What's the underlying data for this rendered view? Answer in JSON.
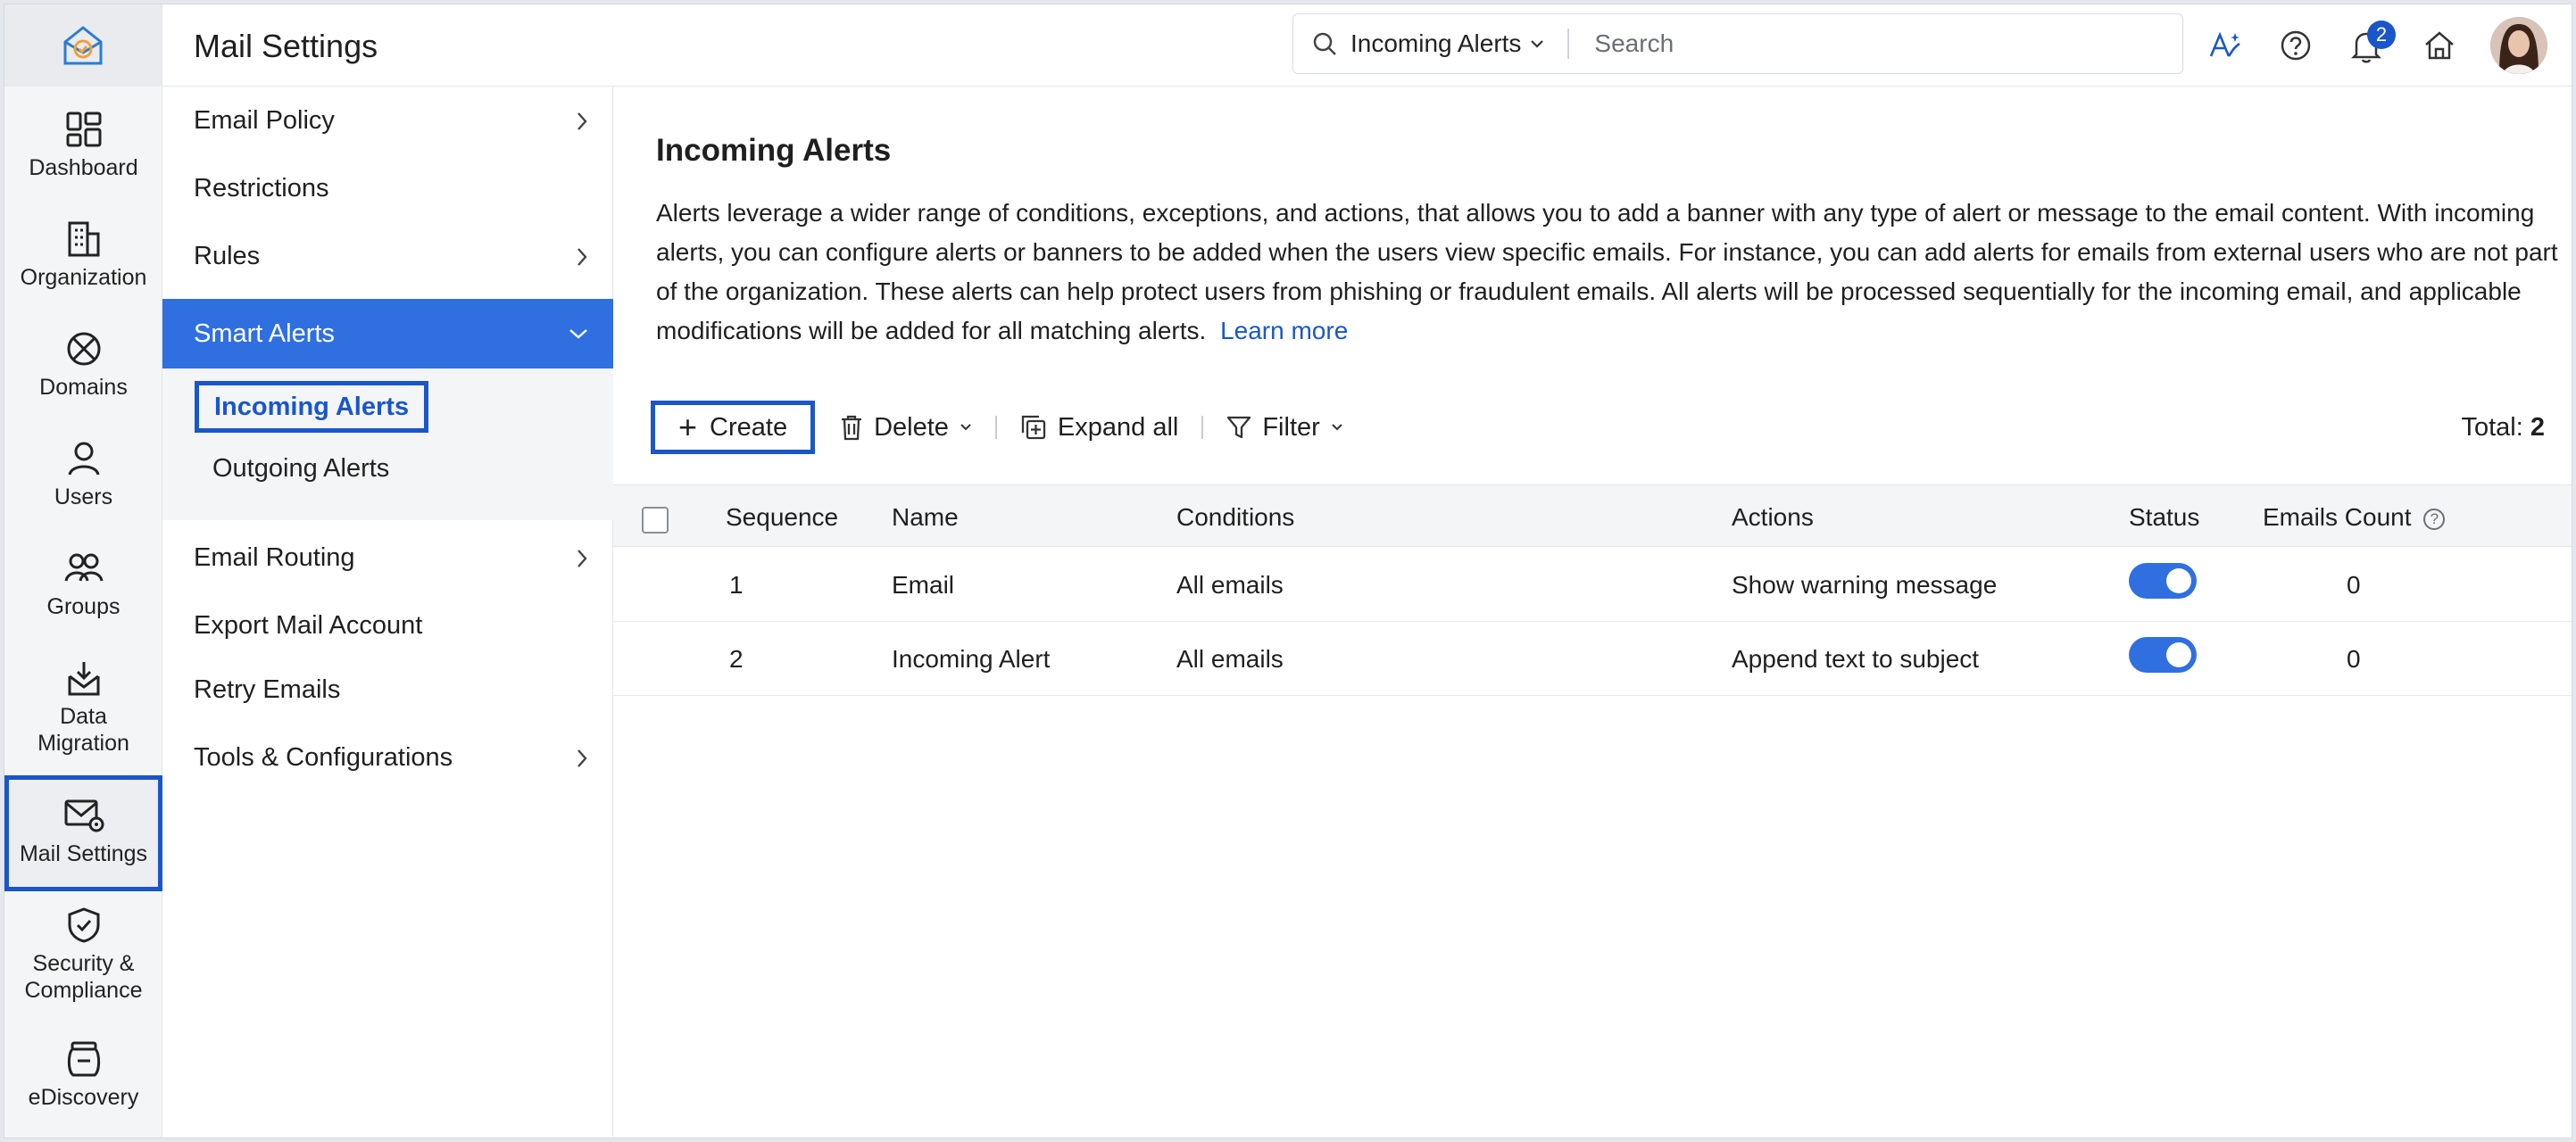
{
  "header": {
    "title": "Mail Settings",
    "search_scope": "Incoming Alerts",
    "search_placeholder": "Search",
    "notification_count": "2"
  },
  "rail": {
    "items": [
      {
        "label": "Dashboard",
        "icon": "dashboard-icon"
      },
      {
        "label": "Organization",
        "icon": "building-icon"
      },
      {
        "label": "Domains",
        "icon": "globe-icon"
      },
      {
        "label": "Users",
        "icon": "user-icon"
      },
      {
        "label": "Groups",
        "icon": "group-icon"
      },
      {
        "label_line1": "Data",
        "label_line2": "Migration",
        "icon": "inbox-download-icon"
      },
      {
        "label": "Mail Settings",
        "icon": "mail-gear-icon",
        "active": true
      },
      {
        "label_line1": "Security &",
        "label_line2": "Compliance",
        "icon": "shield-check-icon"
      },
      {
        "label": "eDiscovery",
        "icon": "archive-jar-icon"
      }
    ]
  },
  "nav": {
    "items": [
      {
        "label": "Email Policy",
        "has_arrow": true
      },
      {
        "label": "Restrictions",
        "has_arrow": false
      },
      {
        "label": "Rules",
        "has_arrow": true
      },
      {
        "label": "Smart Alerts",
        "expanded": true,
        "active": true
      },
      {
        "label": "Email Routing",
        "has_arrow": true
      },
      {
        "label": "Export Mail Account",
        "has_arrow": false
      },
      {
        "label": "Retry Emails",
        "has_arrow": false
      },
      {
        "label": "Tools & Configurations",
        "has_arrow": true
      }
    ],
    "sub_items": [
      {
        "label": "Incoming Alerts",
        "active": true
      },
      {
        "label": "Outgoing Alerts"
      }
    ]
  },
  "content": {
    "title": "Incoming Alerts",
    "description": "Alerts leverage a wider range of conditions, exceptions, and actions, that allows you to add a banner with any type of alert or message to the email content. With incoming alerts, you can configure alerts or banners to be added when the users view specific emails. For instance, you can add alerts for emails from external users who are not part of the organization. These alerts can help protect users from phishing or fraudulent emails. All alerts will be processed sequentially for the incoming email, and applicable modifications will be added for all matching alerts.",
    "learn_more": "Learn more",
    "toolbar": {
      "create": "Create",
      "delete": "Delete",
      "expand_all": "Expand all",
      "filter": "Filter",
      "total_label": "Total:",
      "total_value": "2"
    },
    "table": {
      "columns": [
        "Sequence",
        "Name",
        "Conditions",
        "Actions",
        "Status",
        "Emails Count"
      ],
      "rows": [
        {
          "sequence": "1",
          "name": "Email",
          "conditions": "All emails",
          "actions": "Show warning message",
          "status_on": true,
          "count": "0"
        },
        {
          "sequence": "2",
          "name": "Incoming Alert",
          "conditions": "All emails",
          "actions": "Append text to subject",
          "status_on": true,
          "count": "0"
        }
      ]
    }
  },
  "colors": {
    "accent": "#2f6fe0",
    "highlight_border": "#1a56c9",
    "logo_orange": "#f0a13a",
    "logo_blue": "#2b7cd3"
  }
}
